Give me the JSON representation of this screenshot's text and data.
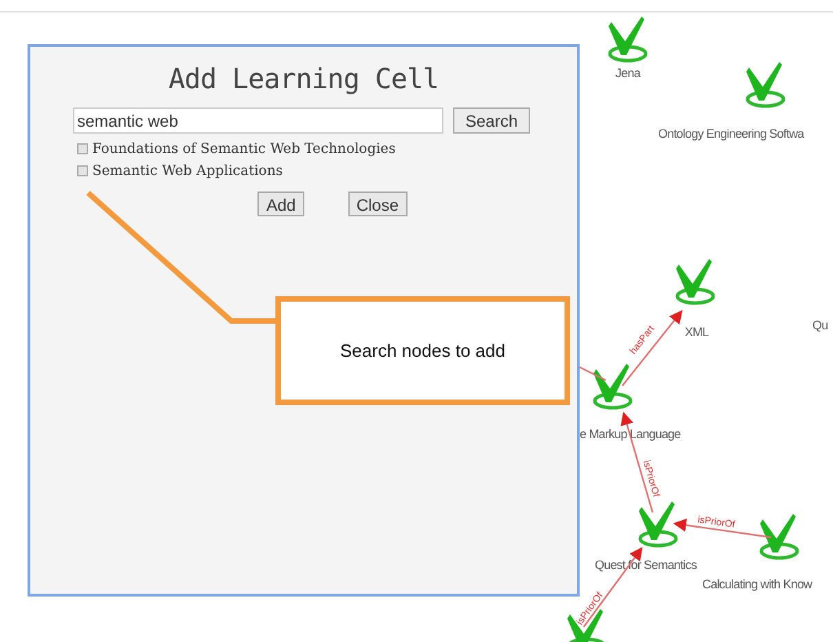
{
  "dialog": {
    "title": "Add Learning Cell",
    "search": {
      "value": "semantic web"
    },
    "search_button": "Search",
    "results": [
      {
        "label": "Foundations of Semantic Web Technologies",
        "checked": false
      },
      {
        "label": "Semantic Web Applications",
        "checked": false
      }
    ],
    "buttons": [
      "Add",
      "Close"
    ]
  },
  "callout": {
    "text": "Search nodes to add"
  },
  "graph": {
    "nodes": [
      {
        "kind": "node",
        "label": "Jena"
      },
      {
        "kind": "node",
        "label": "Ontology Engineering Softwa"
      },
      {
        "kind": "node",
        "label": "XML"
      },
      {
        "kind": "label",
        "label": "Qu"
      },
      {
        "kind": "node",
        "label": "e Markup Language"
      },
      {
        "kind": "node",
        "label": "Quest for Semantics"
      },
      {
        "kind": "node",
        "label": "Calculating with Know"
      },
      {
        "kind": "node"
      }
    ],
    "edges": [
      {
        "label": "hasPart"
      },
      {
        "label": "isPriorOf"
      },
      {
        "label": "isPriorOf"
      },
      {
        "label": "isPriorOf"
      }
    ]
  }
}
